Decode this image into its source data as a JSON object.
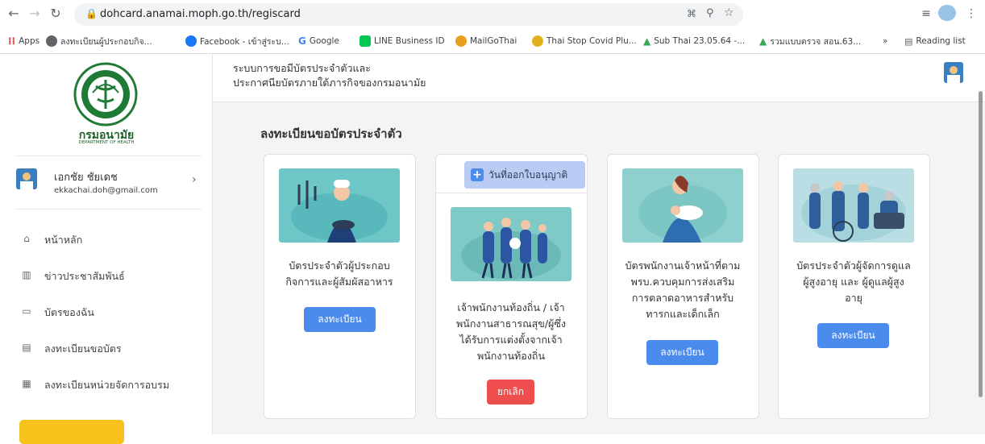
{
  "browser": {
    "url": "dohcard.anamai.moph.go.th/regiscard",
    "bookmarks": [
      {
        "label": "Apps",
        "icon": "apps-grid-icon",
        "color": "#d93025"
      },
      {
        "label": "ลงทะเบียนผู้ประกอบกิจ...",
        "icon": "globe-icon",
        "color": "#5f6368"
      },
      {
        "label": "Facebook - เข้าสู่ระบ...",
        "icon": "facebook-icon",
        "color": "#1877f2"
      },
      {
        "label": "Google",
        "icon": "google-icon",
        "color": "#4285f4"
      },
      {
        "label": "LINE Business ID",
        "icon": "line-icon",
        "color": "#06c755"
      },
      {
        "label": "MailGoThai",
        "icon": "mail-icon",
        "color": "#e8a020"
      },
      {
        "label": "Thai Stop Covid Plu...",
        "icon": "covid-icon",
        "color": "#e0b020"
      },
      {
        "label": "Sub Thai 23.05.64 -...",
        "icon": "drive-icon",
        "color": "#34a853"
      },
      {
        "label": "รวมแบบตรวจ สอน.63...",
        "icon": "drive-icon",
        "color": "#34a853"
      }
    ],
    "more": "»",
    "reading_list": "Reading list"
  },
  "sidebar": {
    "logo_text": "กรมอนามัย",
    "logo_sub": "DEPARTMENT OF HEALTH",
    "user_name": "เอกชัย ชัยเดช",
    "user_email": "ekkachai.doh@gmail.com",
    "menu": [
      {
        "label": "หน้าหลัก",
        "icon": "home-icon"
      },
      {
        "label": "ข่าวประชาสัมพันธ์",
        "icon": "news-icon"
      },
      {
        "label": "บัตรของฉัน",
        "icon": "id-card-icon"
      },
      {
        "label": "ลงทะเบียนขอบัตร",
        "icon": "document-icon"
      },
      {
        "label": "ลงทะเบียนหน่วยจัดการอบรม",
        "icon": "register-unit-icon"
      }
    ]
  },
  "header": {
    "title_line1": "ระบบการขอมีบัตรประจำตัวและ",
    "title_line2": "ประกาศนียบัตรภายใต้ภารกิจของกรมอนามัย"
  },
  "main": {
    "heading": "ลงทะเบียนขอบัตรประจำตัว",
    "cards": [
      {
        "text": [
          "บัตรประจำตัวผู้ประกอบ",
          "กิจการและผู้สัมผัสอาหาร"
        ],
        "button": "ลงทะเบียน",
        "image": "cook-illustration"
      },
      {
        "text": [
          "เจ้าพนักงานท้องถิ่น / เจ้า",
          "พนักงานสาธารณสุข/ผู้ซึ่ง",
          "ได้รับการแต่งตั้งจากเจ้า",
          "พนักงานท้องถิ่น"
        ],
        "button": "ยกเลิก",
        "date_button": "วันที่ออกใบอนุญาติ",
        "image": "health-officers-illustration"
      },
      {
        "text": [
          "บัตรพนักงานเจ้าหน้าที่ตาม",
          "พรบ.ควบคุมการส่งเสริม",
          "การตลาดอาหารสำหรับ",
          "ทารกและเด็กเล็ก"
        ],
        "button": "ลงทะเบียน",
        "image": "mother-baby-illustration"
      },
      {
        "text": [
          "บัตรประจำตัวผู้จัดการดูแล",
          "ผู้สูงอายุ และ ผู้ดูแลผู้สูง",
          "อายุ"
        ],
        "button": "ลงทะเบียน",
        "image": "elderly-care-illustration"
      }
    ]
  },
  "colors": {
    "accent": "#4a8bec",
    "danger": "#ee4e4e",
    "brand_green": "#1f5f2a",
    "yellow": "#f7c21b"
  }
}
